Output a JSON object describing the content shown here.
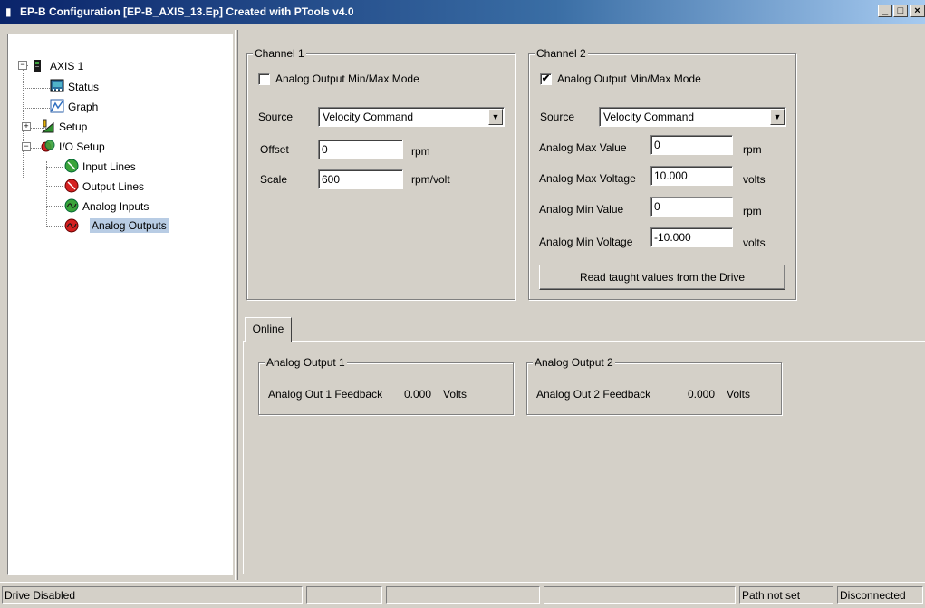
{
  "window": {
    "title": "EP-B Configuration  [EP-B_AXIS_13.Ep] Created with PTools v4.0",
    "minimize": "_",
    "maximize": "□",
    "close": "×"
  },
  "tree": {
    "root": {
      "label": "AXIS 1",
      "expander": "−",
      "icon": "drive-icon"
    },
    "items": [
      {
        "label": "Status",
        "icon": "status-monitor-icon"
      },
      {
        "label": "Graph",
        "icon": "graph-icon"
      },
      {
        "label": "Setup",
        "icon": "setup-icon",
        "expander": "+"
      },
      {
        "label": "I/O Setup",
        "icon": "io-setup-icon",
        "expander": "−"
      },
      {
        "label": "Input Lines",
        "icon": "input-lines-icon"
      },
      {
        "label": "Output Lines",
        "icon": "output-lines-icon"
      },
      {
        "label": "Analog Inputs",
        "icon": "analog-inputs-icon"
      },
      {
        "label": "Analog Outputs",
        "icon": "analog-outputs-icon",
        "selected": true
      }
    ]
  },
  "channel1": {
    "title": "Channel 1",
    "minmax_label": "Analog Output Min/Max Mode",
    "minmax_checked": false,
    "source_label": "Source",
    "source_value": "Velocity Command",
    "offset_label": "Offset",
    "offset_value": "0",
    "offset_unit": "rpm",
    "scale_label": "Scale",
    "scale_value": "600",
    "scale_unit": "rpm/volt"
  },
  "channel2": {
    "title": "Channel 2",
    "minmax_label": "Analog Output Min/Max Mode",
    "minmax_checked": true,
    "check_mark": "✔",
    "source_label": "Source",
    "source_value": "Velocity Command",
    "max_value_label": "Analog Max Value",
    "max_value": "0",
    "max_value_unit": "rpm",
    "max_voltage_label": "Analog Max Voltage",
    "max_voltage": "10.000",
    "max_voltage_unit": "volts",
    "min_value_label": "Analog Min Value",
    "min_value": "0",
    "min_value_unit": "rpm",
    "min_voltage_label": "Analog Min Voltage",
    "min_voltage": "-10.000",
    "min_voltage_unit": "volts",
    "read_button": "Read taught values from the Drive"
  },
  "dropdown_arrow": "▼",
  "online": {
    "tab_label": "Online",
    "out1": {
      "title": "Analog Output 1",
      "label": "Analog Out 1 Feedback",
      "value": "0.000",
      "unit": "Volts"
    },
    "out2": {
      "title": "Analog Output 2",
      "label": "Analog Out 2 Feedback",
      "value": "0.000",
      "unit": "Volts"
    }
  },
  "status": {
    "drive": "Drive Disabled",
    "path": "Path not set",
    "connection": "Disconnected"
  }
}
